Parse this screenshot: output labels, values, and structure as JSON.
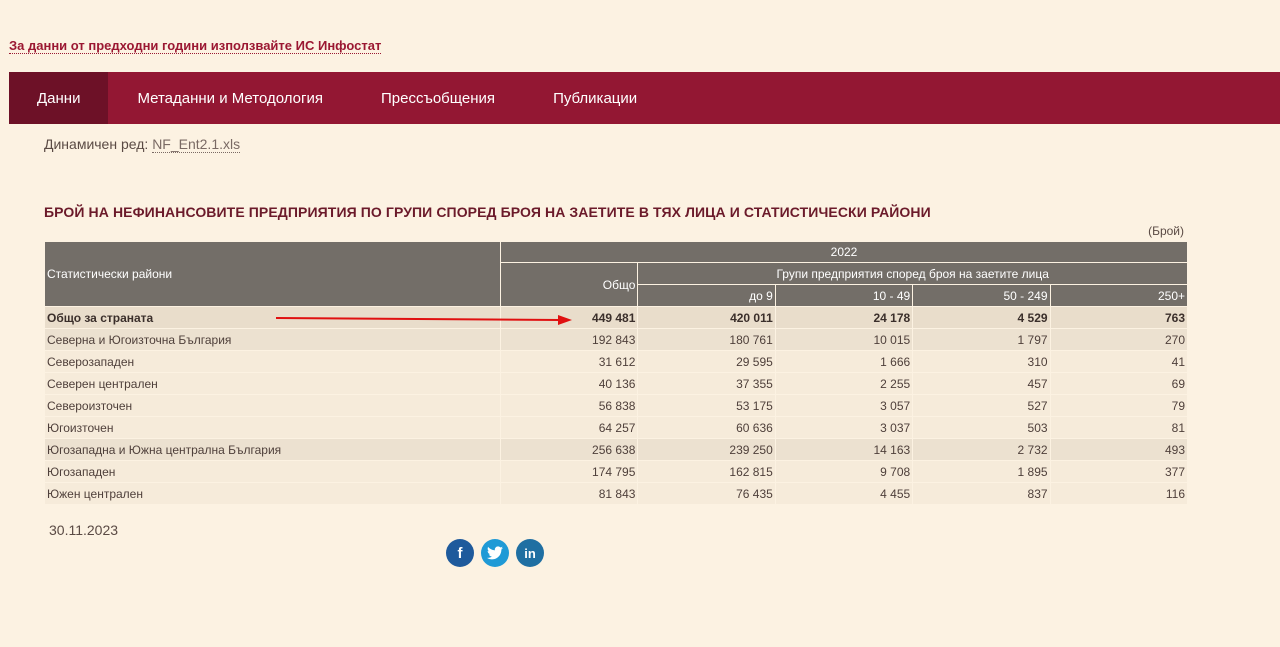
{
  "top_link": "За данни от предходни години използвайте ИС Инфостат",
  "nav": [
    {
      "label": "Данни",
      "active": true
    },
    {
      "label": "Метаданни и Методология"
    },
    {
      "label": "Прессъобщения"
    },
    {
      "label": "Публикации"
    }
  ],
  "dynamic_row": {
    "label": "Динамичен ред:",
    "file": "NF_Ent2.1.xls"
  },
  "table_title": "БРОЙ НА НЕФИНАНСОВИТЕ ПРЕДПРИЯТИЯ ПО ГРУПИ СПОРЕД БРОЯ НА ЗАЕТИТЕ В ТЯХ ЛИЦА И СТАТИСТИЧЕСКИ РАЙОНИ",
  "unit": "(Брой)",
  "headers": {
    "region": "Статистически райони",
    "year": "2022",
    "total": "Общо",
    "groups": "Групи предприятия според броя на заетите лица",
    "g1": "до 9",
    "g2": "10 - 49",
    "g3": "50 - 249",
    "g4": "250+"
  },
  "rows": [
    {
      "region": "Общо за страната",
      "total": "449 481",
      "g1": "420 011",
      "g2": "24 178",
      "g3": "4 529",
      "g4": "763"
    },
    {
      "region": "Северна и Югоизточна България",
      "total": "192 843",
      "g1": "180 761",
      "g2": "10 015",
      "g3": "1 797",
      "g4": "270"
    },
    {
      "region": "Северозападен",
      "total": "31 612",
      "g1": "29 595",
      "g2": "1 666",
      "g3": "310",
      "g4": "41"
    },
    {
      "region": "Северен централен",
      "total": "40 136",
      "g1": "37 355",
      "g2": "2 255",
      "g3": "457",
      "g4": "69"
    },
    {
      "region": "Североизточен",
      "total": "56 838",
      "g1": "53 175",
      "g2": "3 057",
      "g3": "527",
      "g4": "79"
    },
    {
      "region": "Югоизточен",
      "total": "64 257",
      "g1": "60 636",
      "g2": "3 037",
      "g3": "503",
      "g4": "81"
    },
    {
      "region": "Югозападна и Южна централна България",
      "total": "256 638",
      "g1": "239 250",
      "g2": "14 163",
      "g3": "2 732",
      "g4": "493"
    },
    {
      "region": "Югозападен",
      "total": "174 795",
      "g1": "162 815",
      "g2": "9 708",
      "g3": "1 895",
      "g4": "377"
    },
    {
      "region": "Южен централен",
      "total": "81 843",
      "g1": "76 435",
      "g2": "4 455",
      "g3": "837",
      "g4": "116"
    }
  ],
  "date": "30.11.2023",
  "social": {
    "facebook": "f",
    "twitter": "t",
    "linkedin": "in"
  },
  "colors": {
    "nav_bg": "#931733",
    "nav_active": "#6d1127",
    "header_bg": "#736e68",
    "page_bg": "#fcf2e2",
    "arrow": "#e01010"
  }
}
